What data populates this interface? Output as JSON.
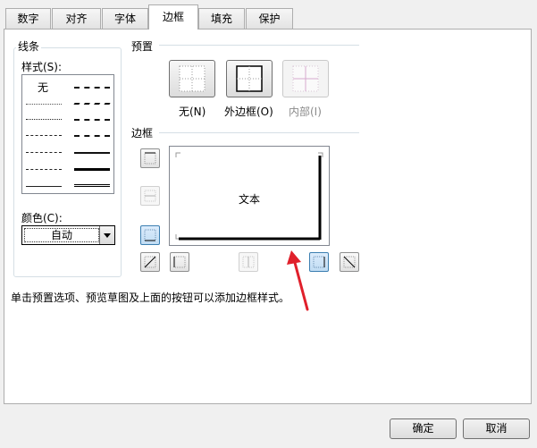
{
  "tabs": [
    {
      "label": "数字"
    },
    {
      "label": "对齐"
    },
    {
      "label": "字体"
    },
    {
      "label": "边框"
    },
    {
      "label": "填充"
    },
    {
      "label": "保护"
    }
  ],
  "active_tab": "边框",
  "line_group": {
    "title": "线条",
    "style_label": "样式(S):",
    "none_label": "无",
    "color_label": "颜色(C):",
    "color_value": "自动"
  },
  "presets": {
    "title": "预置",
    "none_label": "无(N)",
    "outline_label": "外边框(O)",
    "inside_label": "内部(I)"
  },
  "border": {
    "title": "边框",
    "preview_text": "文本"
  },
  "hint": "单击预置选项、预览草图及上面的按钮可以添加边框样式。",
  "buttons": {
    "ok": "确定",
    "cancel": "取消"
  },
  "colors": {
    "accent_red": "#e0202b",
    "pressed_blue": "#3c7fb1"
  }
}
